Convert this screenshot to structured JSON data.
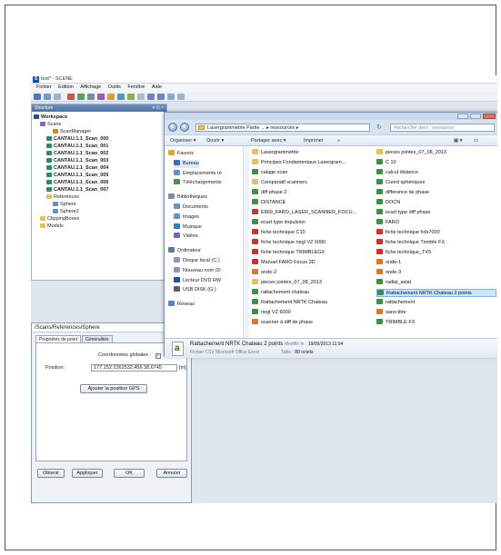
{
  "scene": {
    "title": "test* - SCENE",
    "menu": [
      "Fichier",
      "Edition",
      "Affichage",
      "Outils",
      "Fenêtre",
      "Aide"
    ],
    "panel_title": "Structure",
    "panel_controls": "▾ ⊡ ×",
    "tree": [
      {
        "label": "Workspace",
        "bold": true,
        "indent": 0,
        "icon": "workspace-icon"
      },
      {
        "label": "Scans",
        "bold": false,
        "indent": 1,
        "icon": "scans-icon"
      },
      {
        "label": "ScanManager",
        "bold": false,
        "indent": 3,
        "icon": "scan-manager-icon"
      },
      {
        "label": "CANTAU.1.1_Scan_000",
        "bold": true,
        "indent": 2,
        "icon": "scan-icon"
      },
      {
        "label": "CANTAU.1.1_Scan_001",
        "bold": true,
        "indent": 2,
        "icon": "scan-icon"
      },
      {
        "label": "CANTAU.1.1_Scan_002",
        "bold": true,
        "indent": 2,
        "icon": "scan-icon"
      },
      {
        "label": "CANTAU.1.1_Scan_003",
        "bold": true,
        "indent": 2,
        "icon": "scan-icon"
      },
      {
        "label": "CANTAU.1.1_Scan_004",
        "bold": true,
        "indent": 2,
        "icon": "scan-icon"
      },
      {
        "label": "CANTAU.1.1_Scan_005",
        "bold": true,
        "indent": 2,
        "icon": "scan-icon"
      },
      {
        "label": "CANTAU.1.1_Scan_006",
        "bold": true,
        "indent": 2,
        "icon": "scan-icon"
      },
      {
        "label": "CANTAU.1.1_Scan_007",
        "bold": true,
        "indent": 2,
        "icon": "scan-icon"
      },
      {
        "label": "References",
        "bold": false,
        "indent": 2,
        "icon": "folder-icon"
      },
      {
        "label": "Sphere",
        "bold": false,
        "indent": 3,
        "icon": "sphere-icon"
      },
      {
        "label": "Sphere2",
        "bold": false,
        "indent": 3,
        "icon": "sphere-icon"
      },
      {
        "label": "ClippingBoxes",
        "bold": false,
        "indent": 1,
        "icon": "folder-icon"
      },
      {
        "label": "Models",
        "bold": false,
        "indent": 1,
        "icon": "folder-icon"
      }
    ]
  },
  "dialog": {
    "title": "/Scans/References/Sphere",
    "tabs": [
      "Propriétés de point",
      "Généralités"
    ],
    "global_coords_label": "Coordonnées globales :",
    "global_coords_checked": "✓",
    "position_label": "Position :",
    "position_value": "177.152 2262532.456 38.6745",
    "position_unit": "[m]",
    "gps_button": "Ajouter la position GPS",
    "buttons": {
      "obtain": "Obtenir",
      "apply": "Appliquer",
      "ok": "OK",
      "cancel": "Annuler"
    }
  },
  "explorer": {
    "path": "Lasergrammétrie Partie ... ▸ ressources ▸",
    "search_placeholder": "Rechercher dans : ressources",
    "commands": {
      "organize": "Organiser ▾",
      "open": "Ouvrir ▾",
      "share": "Partager avec ▾",
      "print": "Imprimer",
      "more": "»"
    },
    "nav": [
      {
        "label": "Favoris",
        "icon": "star-icon",
        "group": true
      },
      {
        "label": "Bureau",
        "icon": "desktop-icon",
        "selected": true
      },
      {
        "label": "Emplacements ré",
        "icon": "recent-places-icon"
      },
      {
        "label": "Téléchargements",
        "icon": "downloads-icon"
      },
      {
        "label": "Bibliothèques",
        "icon": "libraries-icon",
        "group": true
      },
      {
        "label": "Documents",
        "icon": "documents-icon"
      },
      {
        "label": "Images",
        "icon": "images-icon"
      },
      {
        "label": "Musique",
        "icon": "music-icon"
      },
      {
        "label": "Vidéos",
        "icon": "videos-icon"
      },
      {
        "label": "Ordinateur",
        "icon": "computer-icon",
        "group": true
      },
      {
        "label": "Disque local (C:)",
        "icon": "drive-icon"
      },
      {
        "label": "Nouveau nom (D",
        "icon": "drive-icon"
      },
      {
        "label": "Lecteur DVD RW",
        "icon": "dvd-icon"
      },
      {
        "label": "USB DISK (G:)",
        "icon": "usb-icon"
      },
      {
        "label": "Réseau",
        "icon": "network-icon",
        "group": true
      }
    ],
    "files_col1": [
      {
        "name": "Lasergrammétrie",
        "type": "folder"
      },
      {
        "name": "Principes Fondamentaux Lasergram...",
        "type": "folder"
      },
      {
        "name": "calage scan",
        "type": "csv"
      },
      {
        "name": "Comparatif scanners",
        "type": "folder"
      },
      {
        "name": "diff phase 2",
        "type": "csv"
      },
      {
        "name": "DISTANCE",
        "type": "csv"
      },
      {
        "name": "E869_FARO_LASER_SCANNER_FOCU...",
        "type": "pdf"
      },
      {
        "name": "ecart type impulsion",
        "type": "csv"
      },
      {
        "name": "fiche technique C10",
        "type": "pdf"
      },
      {
        "name": "fiche technique riegl VZ 6000",
        "type": "pdf"
      },
      {
        "name": "fiche technique TRIMBLEGX",
        "type": "pdf"
      },
      {
        "name": "Manuel FARO Focus 3D",
        "type": "pdf"
      },
      {
        "name": "onde-2",
        "type": "image"
      },
      {
        "name": "pieces jointes_07_08_2013",
        "type": "folder"
      },
      {
        "name": "rattachement chateau",
        "type": "csv"
      },
      {
        "name": "Rattachement NRTK Chateau",
        "type": "csv"
      },
      {
        "name": "riegl VZ 6000",
        "type": "csv"
      },
      {
        "name": "scanner à diff de phase",
        "type": "image"
      }
    ],
    "files_col2": [
      {
        "name": "pieces jointes_07_08_2013",
        "type": "folder"
      },
      {
        "name": "C 10",
        "type": "csv"
      },
      {
        "name": "calcul distance",
        "type": "csv"
      },
      {
        "name": "Coord sphériques",
        "type": "csv"
      },
      {
        "name": "difference de phase",
        "type": "csv"
      },
      {
        "name": "DOCN",
        "type": "csv"
      },
      {
        "name": "ecart type diff phase",
        "type": "csv"
      },
      {
        "name": "FARO",
        "type": "csv"
      },
      {
        "name": "fiche technique hds7000",
        "type": "pdf"
      },
      {
        "name": "fiche technique Trimble FX",
        "type": "pdf"
      },
      {
        "name": "fiche technique_TX5",
        "type": "pdf"
      },
      {
        "name": "onde-1",
        "type": "image"
      },
      {
        "name": "onde-3",
        "type": "image"
      },
      {
        "name": "radial_axial",
        "type": "csv"
      },
      {
        "name": "Rattachement NRTK Chateau 2 points",
        "type": "csv",
        "selected": true
      },
      {
        "name": "rattachement",
        "type": "csv"
      },
      {
        "name": "sans-titre",
        "type": "image"
      },
      {
        "name": "TRIMBLE FX",
        "type": "csv"
      }
    ],
    "details": {
      "name": "Rattachement NRTK Chateau 2 points",
      "modified_label": "Modifié le :",
      "modified_value": "19/09/2013 11:04",
      "type": "Fichier CSV Microsoft Office Excel",
      "size_label": "Taille :",
      "size_value": "80 octets"
    }
  },
  "colors": {
    "folder": "#e5c35a",
    "csv": "#3f8f4a",
    "pdf": "#c8342b",
    "image": "#d9772b",
    "accent": "#4e73a2"
  }
}
